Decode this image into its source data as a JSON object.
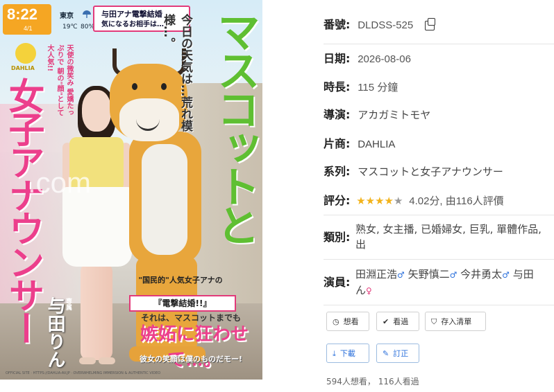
{
  "cover": {
    "time": "8:22",
    "date": "4/1",
    "city": "東京",
    "temperature": "19℃",
    "rain_chance": "80%",
    "news_line1": "与田アナ電撃結婚",
    "news_line2": "気になるお相手は…",
    "logo": "DAHLIA",
    "tagline": "天使の微笑み 愛嬌たっぷりで 朝の\"顔\"として大人気!!",
    "title_pink": "女子アナウンサー",
    "title_green": "マスコットと",
    "weather_line": "今日の天気は…荒れ模様…。",
    "watermark": ".com",
    "speech1": "\"国民的\"人気女子アナの",
    "speech_news": "『電撃結婚!!』",
    "speech2": "それは、マスコットまでも",
    "big_pink": "嫉妬に狂わせて…。",
    "bottom_line": "彼女の笑顔は僕のものだモー!",
    "actress_name": "与田りん",
    "exclusive": "専属",
    "credits": "OFFICIAL SITE · HTTPS://DAHLIA-AV.JP · OVERWHELMING IMMERSION & AUTHENTIC VIDEO"
  },
  "info": {
    "code_label": "番號:",
    "code_value": "DLDSS-525",
    "date_label": "日期:",
    "date_value": "2026-08-06",
    "length_label": "時長:",
    "length_value": "115 分鐘",
    "director_label": "導演:",
    "director_value": "アカガミトモヤ",
    "maker_label": "片商:",
    "maker_value": "DAHLIA",
    "series_label": "系列:",
    "series_value": "マスコットと女子アナウンサー",
    "rating_label": "評分:",
    "rating_stars": 4,
    "rating_text": "4.02分, 由116人評價",
    "genre_label": "類別:",
    "genres_line1": "熟女, 女主播, 已婚婦女, 巨乳, 單體作品,",
    "genres_line2": "出",
    "cast_label": "演員:",
    "cast": [
      {
        "name": "田淵正浩",
        "gender": "male"
      },
      {
        "name": "矢野慎二",
        "gender": "male"
      },
      {
        "name": "今井勇太",
        "gender": "male"
      },
      {
        "name": "与田",
        "gender": ""
      }
    ],
    "cast_overflow": "ん",
    "cast_overflow_gender": "female"
  },
  "actions": {
    "want_label": "想看",
    "watched_label": "看過",
    "save_label": "存入清單",
    "download_label": "下載",
    "correct_label": "訂正"
  },
  "stats": {
    "counts_text": "594人想看， 116人看過"
  },
  "icons": {
    "copy": "copy-icon",
    "want": "clock-icon",
    "watched": "check-icon",
    "save": "bookmark-icon",
    "download": "download-icon",
    "correct": "edit-icon"
  },
  "colors": {
    "star": "#f2b31b",
    "male": "#2a6fdb",
    "female": "#e23a7a",
    "title_pink": "#ec3f8c",
    "title_green": "#5fbf32"
  }
}
